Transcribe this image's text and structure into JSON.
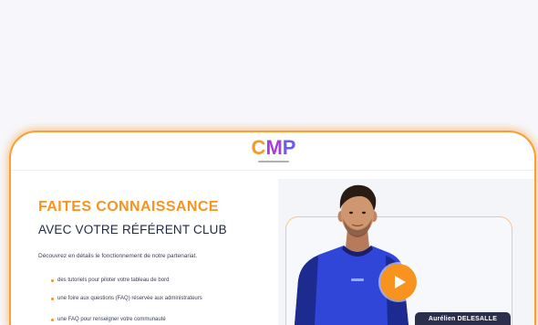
{
  "logo": {
    "letters": [
      "C",
      "M",
      "P"
    ],
    "letter_colors": [
      "#f39a2b",
      "#a63fd6",
      "#6a5cf0"
    ]
  },
  "heading": {
    "line1": "FAITES CONNAISSANCE",
    "line2": "AVEC VOTRE RÉFÉRENT CLUB"
  },
  "intro": "Découvrez en détails le fonctionnement de notre partenariat.",
  "bullets": [
    "des tutoriels pour piloter votre tableau de bord",
    "une foire aux questions (FAQ) réservée aux administrateurs",
    "une FAQ pour renseigner votre communauté"
  ],
  "video": {
    "presenter_name": "Aurélien DELESALLE",
    "play_icon": "play-icon"
  },
  "colors": {
    "accent": "#f7931e",
    "navy": "#1f2a44",
    "badge": "#2b2f4c"
  }
}
